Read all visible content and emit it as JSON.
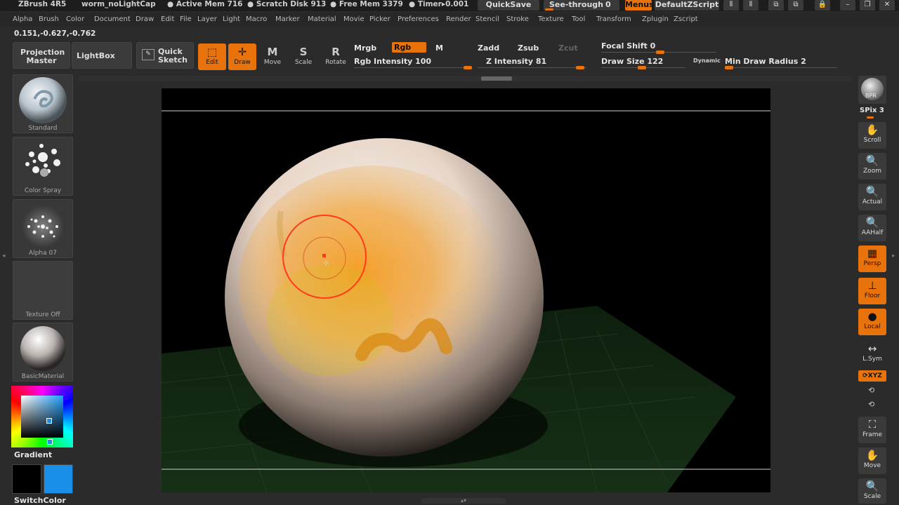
{
  "titlebar": {
    "app": "ZBrush 4R5",
    "doc": "worm_noLightCap",
    "active_mem": "● Active Mem 716",
    "scratch": "● Scratch Disk 913",
    "free_mem": "● Free Mem 3379",
    "timer": "● Timer▸0.001",
    "quicksave": "QuickSave",
    "see_through": "See-through",
    "see_through_val": "0",
    "menus": "Menus",
    "script": "DefaultZScript"
  },
  "menu": [
    "Alpha",
    "Brush",
    "Color",
    "Document",
    "Draw",
    "Edit",
    "File",
    "Layer",
    "Light",
    "Macro",
    "Marker",
    "Material",
    "Movie",
    "Picker",
    "Preferences",
    "Render",
    "Stencil",
    "Stroke",
    "Texture",
    "Tool",
    "Transform",
    "Zplugin",
    "Zscript"
  ],
  "coords": "0.151,-0.627,-0.762",
  "shelf": {
    "projection_master": "Projection Master",
    "lightbox": "LightBox",
    "quick_sketch": "Quick Sketch",
    "tools": [
      {
        "label": "Edit",
        "icon": "edit-icon",
        "on": true
      },
      {
        "label": "Draw",
        "icon": "draw-icon",
        "on": true
      },
      {
        "label": "Move",
        "icon": "move-icon",
        "on": false
      },
      {
        "label": "Scale",
        "icon": "scale-icon",
        "on": false
      },
      {
        "label": "Rotate",
        "icon": "rotate-icon",
        "on": false
      }
    ],
    "mrgb": "Mrgb",
    "rgb": "Rgb",
    "m": "M",
    "rgb_intensity": "Rgb Intensity 100",
    "zadd": "Zadd",
    "zsub": "Zsub",
    "zcut": "Zcut",
    "z_intensity": "Z Intensity 81",
    "focal_shift": "Focal Shift 0",
    "draw_size": "Draw Size 122",
    "dynamic": "Dynamic",
    "min_draw_radius": "Min Draw Radius 2",
    "rgb_intensity_value": 100,
    "z_intensity_value": 81
  },
  "left": {
    "brush": "Standard",
    "stroke": "Color Spray",
    "alpha": "Alpha 07",
    "texture": "Texture Off",
    "material": "BasicMaterial",
    "gradient": "Gradient",
    "switchcolor": "SwitchColor",
    "primary_color": "#000000",
    "secondary_color": "#1a8fe8"
  },
  "right": {
    "bpr": "BPR",
    "spix": "SPix 3",
    "buttons": [
      {
        "label": "Scroll",
        "icon": "hand-icon",
        "on": false
      },
      {
        "label": "Zoom",
        "icon": "zoom-icon",
        "on": false
      },
      {
        "label": "Actual",
        "icon": "actual-icon",
        "on": false
      },
      {
        "label": "AAHalf",
        "icon": "aahalf-icon",
        "on": false
      },
      {
        "label": "Persp",
        "icon": "persp-icon",
        "on": true
      },
      {
        "label": "Floor",
        "icon": "floor-icon",
        "on": true
      },
      {
        "label": "Local",
        "icon": "local-icon",
        "on": true
      },
      {
        "label": "L.Sym",
        "icon": "lsym-icon",
        "on": false
      },
      {
        "label": "Frame",
        "icon": "frame-icon",
        "on": false
      },
      {
        "label": "Move",
        "icon": "move-icon",
        "on": false
      },
      {
        "label": "Scale",
        "icon": "scale-icon",
        "on": false
      }
    ],
    "xyz": "⟳XYZ"
  },
  "colors": {
    "accent": "#e8730c",
    "panel": "#383838",
    "bg": "#2b2b2b"
  }
}
